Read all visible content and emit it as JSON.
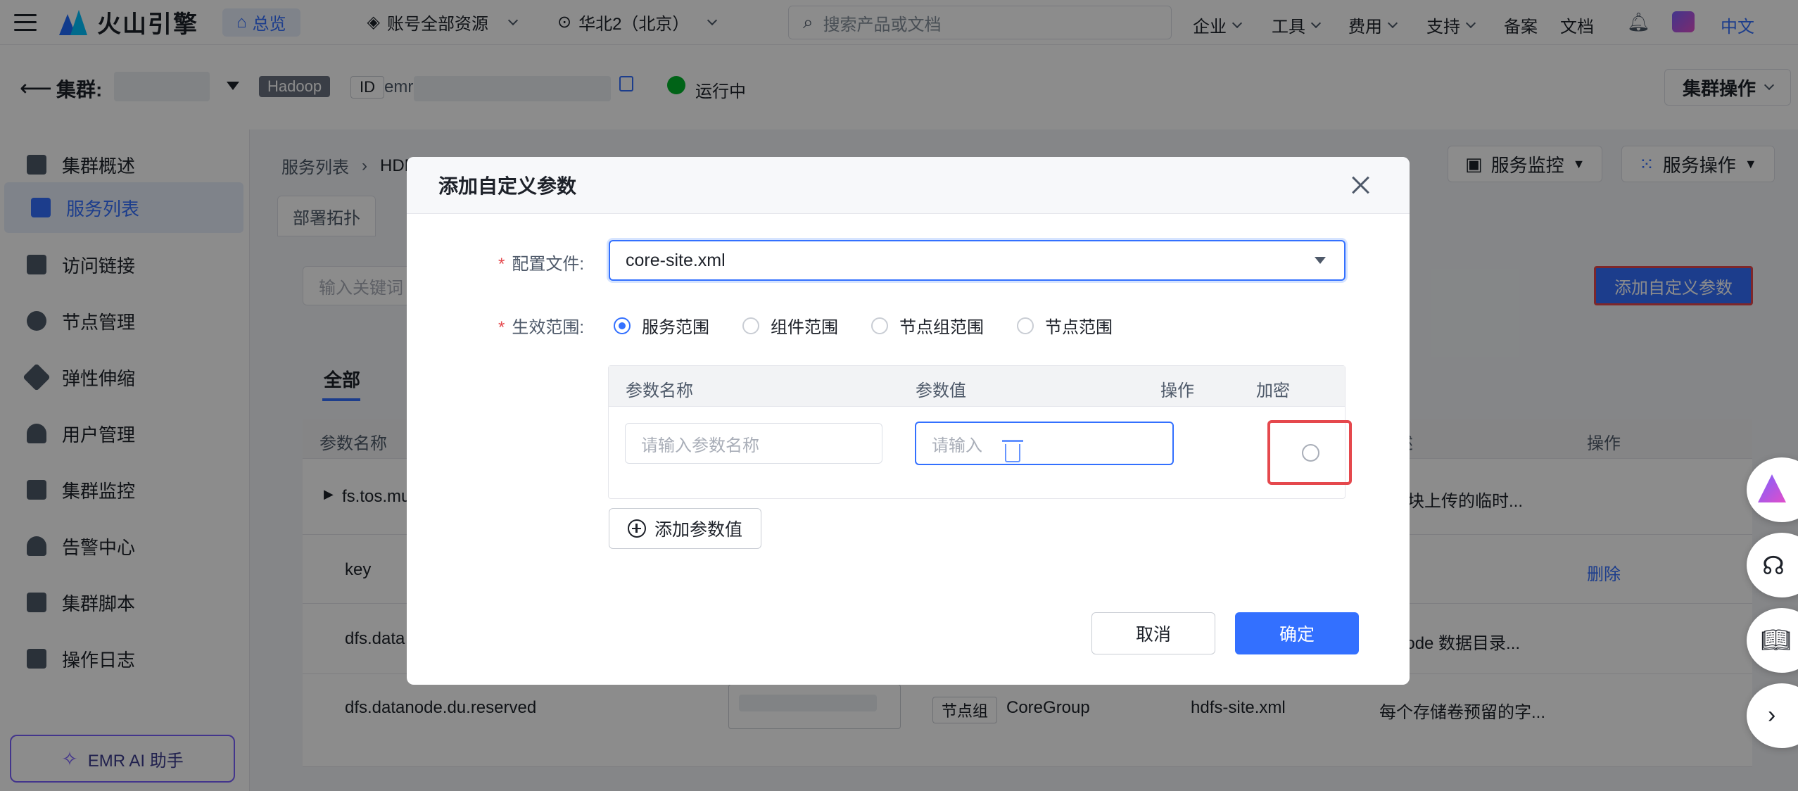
{
  "topbar": {
    "brand": "火山引擎",
    "overview": "总览",
    "account_resources": "账号全部资源",
    "region": "华北2（北京）",
    "search_placeholder": "搜索产品或文档",
    "menus": [
      "企业",
      "工具",
      "费用",
      "支持"
    ],
    "links": [
      "备案",
      "文档"
    ],
    "language": "中文"
  },
  "cluster": {
    "title": "集群:",
    "type_tag": "Hadoop",
    "id_label": "ID",
    "id_prefix": "emr",
    "status": "运行中",
    "ops_button": "集群操作"
  },
  "sidebar": {
    "items": [
      {
        "label": "集群概述"
      },
      {
        "label": "服务列表"
      },
      {
        "label": "访问链接"
      },
      {
        "label": "节点管理"
      },
      {
        "label": "弹性伸缩"
      },
      {
        "label": "用户管理"
      },
      {
        "label": "集群监控"
      },
      {
        "label": "告警中心"
      },
      {
        "label": "集群脚本"
      },
      {
        "label": "操作日志"
      }
    ],
    "ai_assistant": "EMR AI 助手"
  },
  "main": {
    "breadcrumb": [
      "服务列表",
      "HDFS"
    ],
    "tab_deploy": "部署拓扑",
    "monitor_button": "服务监控",
    "service_ops_button": "服务操作",
    "keyword_placeholder": "输入关键词",
    "add_custom_param": "添加自定义参数",
    "filter_all": "全部",
    "table_headers": {
      "name": "参数名称",
      "desc": "描述",
      "ops": "操作"
    },
    "rows": [
      {
        "name": "fs.tos.mu",
        "desc": "S分块上传的临时..."
      },
      {
        "name": "key",
        "op": "删除"
      },
      {
        "name": "dfs.data",
        "desc": "taNode 数据目录..."
      },
      {
        "name": "dfs.datanode.du.reserved",
        "scope_tag": "节点组",
        "scope": "CoreGroup",
        "file": "hdfs-site.xml",
        "desc": "每个存储卷预留的字..."
      }
    ]
  },
  "modal": {
    "title": "添加自定义参数",
    "config_file_label": "配置文件:",
    "config_file_value": "core-site.xml",
    "scope_label": "生效范围:",
    "scope_options": [
      "服务范围",
      "组件范围",
      "节点组范围",
      "节点范围"
    ],
    "table_headers": {
      "name": "参数名称",
      "value": "参数值",
      "op": "操作",
      "encrypt": "加密"
    },
    "name_placeholder": "请输入参数名称",
    "value_placeholder": "请输入",
    "add_value_button": "添加参数值",
    "cancel_button": "取消",
    "ok_button": "确定"
  },
  "colors": {
    "primary": "#3370ff",
    "highlight_border": "#e5484d",
    "status_green": "#00b42a"
  }
}
